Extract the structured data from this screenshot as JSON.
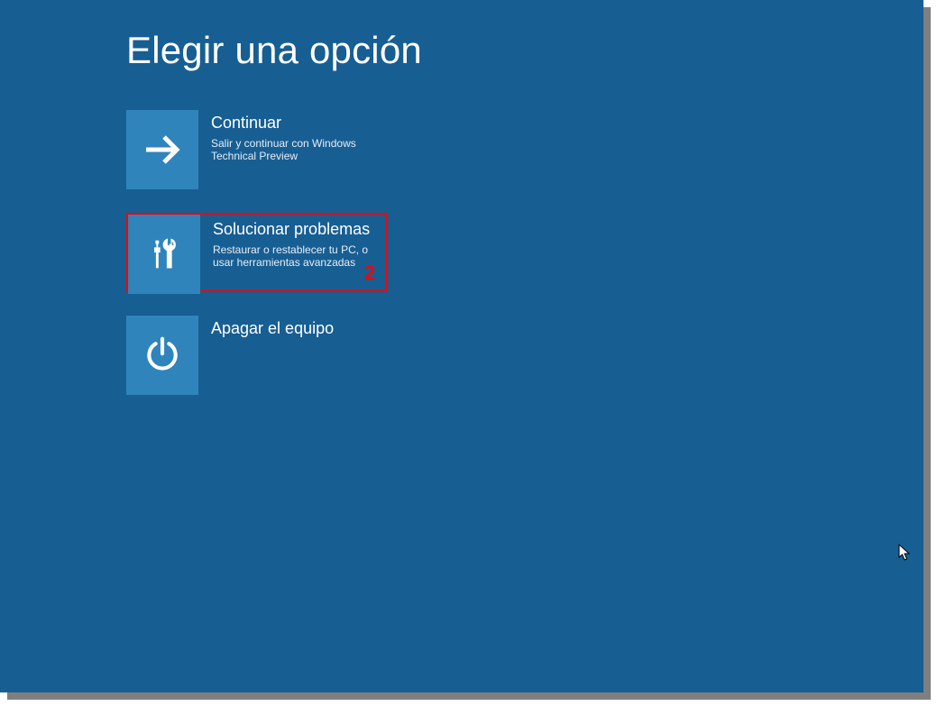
{
  "title": "Elegir una opción",
  "options": [
    {
      "id": "continue",
      "icon": "arrow-right-icon",
      "title": "Continuar",
      "desc": "Salir y continuar con Windows Technical Preview",
      "badge": null,
      "highlight": false
    },
    {
      "id": "troubleshoot",
      "icon": "tools-icon",
      "title": "Solucionar problemas",
      "desc": "Restaurar o restablecer tu PC, o usar herramientas avanzadas",
      "badge": "2",
      "highlight": true
    },
    {
      "id": "shutdown",
      "icon": "power-icon",
      "title": "Apagar el equipo",
      "desc": "",
      "badge": null,
      "highlight": false
    }
  ],
  "colors": {
    "screen_bg": "#175e93",
    "tile_bg": "#2f84bb",
    "highlight_border": "#ff0000",
    "text": "#ffffff"
  }
}
